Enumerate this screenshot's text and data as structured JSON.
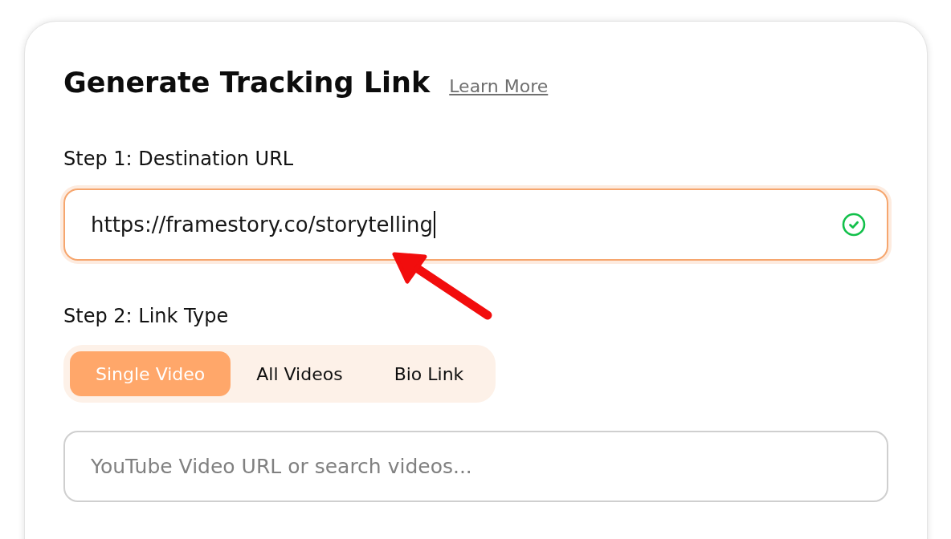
{
  "header": {
    "title": "Generate Tracking Link",
    "link": "Learn More"
  },
  "destination": {
    "label": "Step 1: Destination URL",
    "value": "https://framestory.co/storytelling",
    "focused": true,
    "valid": true
  },
  "link_type": {
    "label": "Step 2: Link Type",
    "options": [
      {
        "label": "Single Video",
        "selected": true
      },
      {
        "label": "All Videos",
        "selected": false
      },
      {
        "label": "Bio Link",
        "selected": false
      }
    ]
  },
  "video_search": {
    "placeholder": "YouTube Video URL or search videos..."
  }
}
